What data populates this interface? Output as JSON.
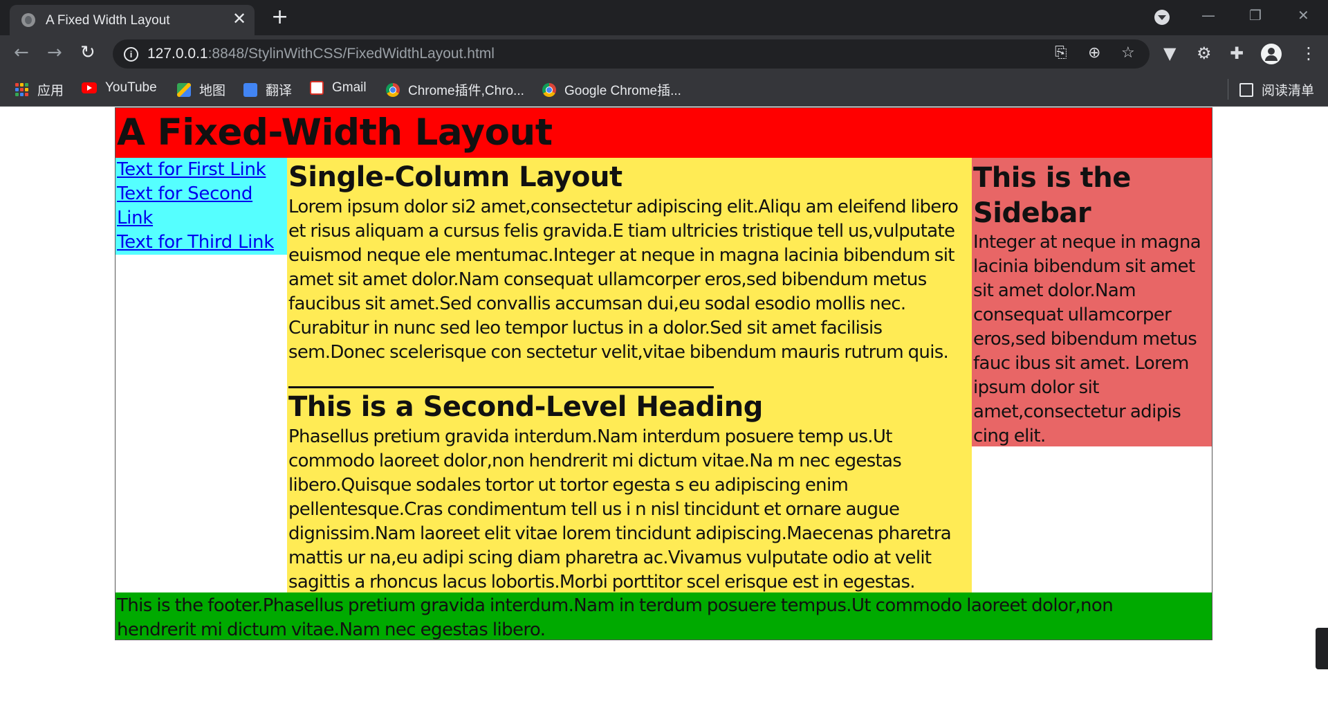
{
  "browser": {
    "tab_title": "A Fixed Width Layout",
    "tab_close": "✕",
    "new_tab": "+",
    "url_host": "127.0.0.1",
    "url_path": ":8848/StylinWithCSS/FixedWidthLayout.html",
    "bookmarks": [
      {
        "label": "应用",
        "icon": "apps-icon"
      },
      {
        "label": "YouTube",
        "icon": "youtube-icon"
      },
      {
        "label": "地图",
        "icon": "maps-icon"
      },
      {
        "label": "翻译",
        "icon": "translate-icon"
      },
      {
        "label": "Gmail",
        "icon": "gmail-icon"
      },
      {
        "label": "Chrome插件,Chro...",
        "icon": "chrome-icon"
      },
      {
        "label": "Google Chrome插...",
        "icon": "chrome-icon"
      }
    ],
    "reading_list": "阅读清单"
  },
  "page": {
    "header_title": "A Fixed-Width Layout",
    "nav_links": [
      "Text for First Link",
      "Text for Second Link",
      "Text for Third Link"
    ],
    "content": {
      "heading1": "Single-Column Layout",
      "para1": "Lorem ipsum dolor si2 amet,consectetur adipiscing elit.Aliqu am eleifend libero et risus aliquam a cursus felis gravida.E tiam ultricies tristique tell us,vulputate euismod neque ele mentumac.Integer at neque in magna lacinia bibendum sit amet sit amet dolor.Nam consequat ullamcorper eros,sed bibendum metus faucibus sit amet.Sed convallis accumsan dui,eu sodal esodio mollis nec. Curabitur in nunc sed leo tempor luctus in a dolor.Sed sit amet facilisis sem.Donec scelerisque con sectetur velit,vitae bibendum mauris rutrum quis.",
      "heading2": "This is a Second-Level Heading",
      "para2": "Phasellus pretium gravida interdum.Nam interdum posuere temp us.Ut commodo laoreet dolor,non hendrerit mi dictum vitae.Na m nec egestas libero.Quisque sodales tortor ut tortor egesta s eu adipiscing enim pellentesque.Cras condimentum tell us i n nisl tincidunt et ornare augue dignissim.Nam laoreet elit vitae lorem tincidunt adipiscing.Maecenas pharetra mattis ur na,eu adipi scing diam pharetra ac.Vivamus vulputate odio at velit sagittis a rhoncus lacus lobortis.Morbi porttitor scel erisque est in egestas."
    },
    "sidebar": {
      "heading": "This is the Sidebar",
      "text": "Integer at neque in magna lacinia bibendum sit amet sit amet dolor.Nam consequat ullamcorper eros,sed bibendum metus fauc ibus sit amet. Lorem ipsum dolor sit amet,consectetur adipis cing elit."
    },
    "footer": "This is the footer.Phasellus pretium gravida interdum.Nam in terdum posuere tempus.Ut commodo laoreet dolor,non hendrerit mi dictum vitae.Nam nec egestas libero."
  },
  "colors": {
    "header_bg": "#ff0000",
    "nav_bg": "#55ffff",
    "content_bg": "#ffeb55",
    "sidebar_bg": "#e86666",
    "footer_bg": "#00aa00"
  }
}
